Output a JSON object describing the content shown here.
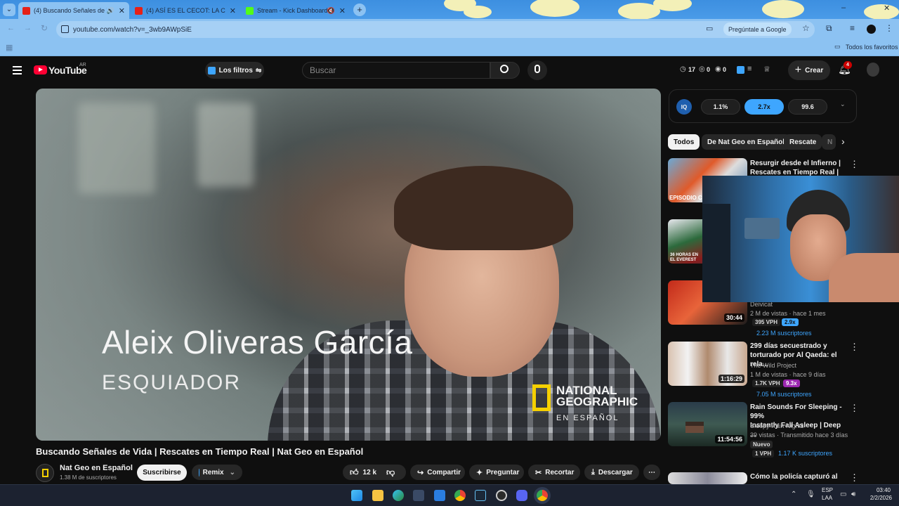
{
  "browser": {
    "tabs": [
      {
        "title": "(4) Buscando Señales de Vi",
        "active": true
      },
      {
        "title": "(4) ASÍ ES EL CECOT: LA CÁRCE",
        "active": false
      },
      {
        "title": "Stream - Kick Dashboard",
        "active": false
      }
    ],
    "url": "youtube.com/watch?v=_3wb9AWpSiE",
    "ask_google": "Pregúntale a Google",
    "favorites": "Todos los favoritos"
  },
  "youtube": {
    "logo": "YouTube",
    "country": "AR",
    "filters": "Los filtros",
    "search_placeholder": "Buscar",
    "stats": {
      "a": "17",
      "b": "0",
      "c": "0"
    },
    "create": "Crear",
    "notifications": "4"
  },
  "video": {
    "overlay_name": "Aleix Oliveras García",
    "overlay_role": "ESQUIADOR",
    "brand_line1": "NATIONAL",
    "brand_line2": "GEOGRAPHIC",
    "brand_line3": "EN ESPAÑOL",
    "title": "Buscando Señales de Vida | Rescates en Tiempo Real | Nat Geo en Español",
    "channel": "Nat Geo en Español",
    "subscribers": "1.38 M de suscriptores",
    "subscribe": "Suscribirse",
    "remix": "Remix",
    "likes": "12 k",
    "share": "Compartir",
    "ask": "Preguntar",
    "clip": "Recortar",
    "download": "Descargar"
  },
  "iq": {
    "label": "IQ",
    "v1": "1.1%",
    "v2": "2.7x",
    "v3": "99.6"
  },
  "chips": [
    "Todos",
    "De Nat Geo en Español",
    "Rescate",
    "N"
  ],
  "recommended": [
    {
      "title1": "Resurgir desde el Infierno |",
      "title2": "Rescates en Tiempo Real | Nat...",
      "thumb_text": "EPISODIO C"
    },
    {
      "thumb_text1": "36 HORAS EN",
      "thumb_text2": "EL EVEREST"
    },
    {
      "channel": "Deivicat",
      "meta": "2 M de vistas · hace 1 mes",
      "duration": "30:44",
      "vph": "395 VPH",
      "mult": "2.9x",
      "subs": "2.23 M suscriptores"
    },
    {
      "title1": "299 días secuestrado y",
      "title2": "torturado por Al Qaeda: el rela...",
      "channel": "The Wild Project",
      "meta": "1 M de vistas · hace 9 días",
      "duration": "1:16:29",
      "vph": "1.7K VPH",
      "mult": "9.3x",
      "subs": "7.05 M suscriptores"
    },
    {
      "title1": "Rain Sounds For Sleeping - 99%",
      "title2": "Instantly Fall Asleep | Deep ...",
      "channel": "Sleepy Rain Nights",
      "meta": "39 vistas · Transmitido hace 3 días",
      "duration": "11:54:56",
      "badge": "Nuevo",
      "vph": "1 VPH",
      "subs": "1.17 K suscriptores"
    },
    {
      "title1": "Cómo la policía capturó al"
    }
  ],
  "taskbar": {
    "lang1": "ESP",
    "lang2": "LAA",
    "time": "03:40",
    "date": "2/2/2026"
  }
}
